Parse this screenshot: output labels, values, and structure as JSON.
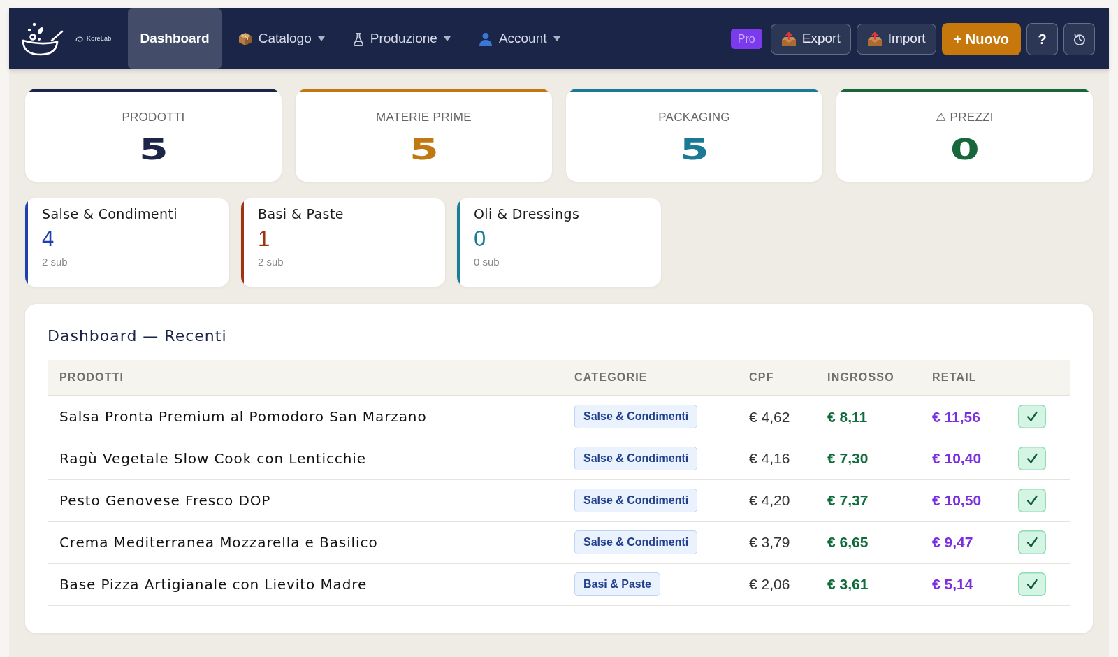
{
  "nav": {
    "brand": "KoreLab",
    "items": [
      {
        "label": "Dashboard",
        "selected": true,
        "dropdown": false
      },
      {
        "label": "Catalogo",
        "selected": false,
        "dropdown": true
      },
      {
        "label": "Produzione",
        "selected": false,
        "dropdown": true
      },
      {
        "label": "Account",
        "selected": false,
        "dropdown": true
      }
    ]
  },
  "toolbar": {
    "plan_badge": "Pro",
    "buttons": [
      {
        "label": "Export"
      },
      {
        "label": "Import"
      }
    ],
    "new_button": "+ Nuovo",
    "help_button": "?"
  },
  "stats": [
    {
      "label": "PRODOTTI",
      "value": "5",
      "color": "#1b2547"
    },
    {
      "label": "MATERIE PRIME",
      "value": "5",
      "color": "#c27811"
    },
    {
      "label": "PACKAGING",
      "value": "5",
      "color": "#1a7a96"
    },
    {
      "label": "⚠ PREZZI",
      "value": "0",
      "color": "#17673a"
    }
  ],
  "categories": [
    {
      "name": "Salse & Condimenti",
      "count": "4",
      "sub": "2 sub",
      "color": "#1f3fae"
    },
    {
      "name": "Basi & Paste",
      "count": "1",
      "sub": "2 sub",
      "color": "#9c3412"
    },
    {
      "name": "Oli & Dressings",
      "count": "0",
      "sub": "0 sub",
      "color": "#177e94"
    }
  ],
  "recent": {
    "title": "Dashboard — Recenti",
    "columns": [
      "PRODOTTI",
      "CATEGORIE",
      "CPF",
      "INGROSSO",
      "RETAIL"
    ],
    "rows": [
      {
        "product": "Salsa Pronta Premium al Pomodoro San Marzano",
        "category": "Salse & Condimenti",
        "cpf": "€ 4,62",
        "ingrosso": "€ 8,11",
        "retail": "€ 11,56",
        "verified": true
      },
      {
        "product": "Ragù Vegetale Slow Cook con Lenticchie",
        "category": "Salse & Condimenti",
        "cpf": "€ 4,16",
        "ingrosso": "€ 7,30",
        "retail": "€ 10,40",
        "verified": true
      },
      {
        "product": "Pesto Genovese Fresco DOP",
        "category": "Salse & Condimenti",
        "cpf": "€ 4,20",
        "ingrosso": "€ 7,37",
        "retail": "€ 10,50",
        "verified": true
      },
      {
        "product": "Crema Mediterranea Mozzarella e Basilico",
        "category": "Salse & Condimenti",
        "cpf": "€ 3,79",
        "ingrosso": "€ 6,65",
        "retail": "€ 9,47",
        "verified": true
      },
      {
        "product": "Base Pizza Artigianale con Lievito Madre",
        "category": "Basi & Paste",
        "cpf": "€ 2,06",
        "ingrosso": "€ 3,61",
        "retail": "€ 5,14",
        "verified": true
      }
    ]
  }
}
